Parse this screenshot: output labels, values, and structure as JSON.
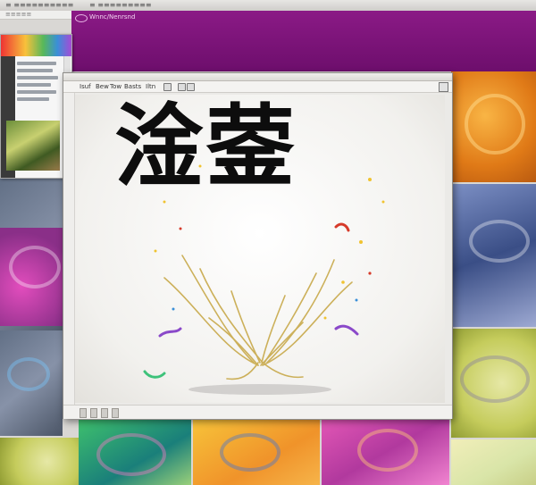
{
  "topbar": {
    "left_text": "≡ ≡≡≡≡≡≡≡≡≡≡",
    "mid_text": "≡ ≡≡≡≡≡≡≡≡≡",
    "menu_text": "≡≡≡≡≡"
  },
  "banner": {
    "title": "Wnnc/Nenrsnd"
  },
  "window": {
    "menu_items": [
      "Isuf",
      "Bew",
      "Tow",
      "Basts",
      "Iltn"
    ],
    "artwork_text": "淦蓥"
  },
  "colors": {
    "banner": "#7a1277",
    "ink": "#0d0d0d",
    "gold": "#c8a94a"
  },
  "icons": {
    "banner_logo": "logo-icon",
    "window_corner": "window-control-icon",
    "status": "status-icon"
  }
}
